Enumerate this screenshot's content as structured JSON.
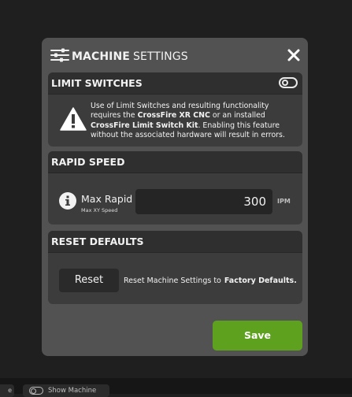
{
  "dialog": {
    "title_bold": "MACHINE",
    "title_light": "SETTINGS",
    "close_icon": "close-icon",
    "settings_icon": "sliders-icon"
  },
  "limit_switches": {
    "header": "LIMIT SWITCHES",
    "toggle_on": false,
    "warning_icon": "warning-triangle-icon",
    "text_1": "Use of Limit Switches and resulting functionality requires the ",
    "bold_1": "CrossFire XR CNC",
    "text_2": " or an installed ",
    "bold_2": "CrossFire Limit Switch Kit",
    "text_3": ". Enabling this feature without the associated hardware will result in errors."
  },
  "rapid_speed": {
    "header": "RAPID SPEED",
    "info_icon": "info-icon",
    "label": "Max Rapid",
    "sublabel": "Max XY Speed",
    "value": "300",
    "unit": "IPM"
  },
  "reset_defaults": {
    "header": "RESET DEFAULTS",
    "button": "Reset",
    "description": "Reset Machine Settings to",
    "description_bold": "Factory Defaults."
  },
  "footer": {
    "save_label": "Save"
  },
  "background_bar": {
    "left_button": "e",
    "toggle_label": "Show Machine"
  },
  "colors": {
    "save": "#5da11e",
    "modal_bg": "#525252",
    "panel_bg": "#3c3c3c"
  }
}
